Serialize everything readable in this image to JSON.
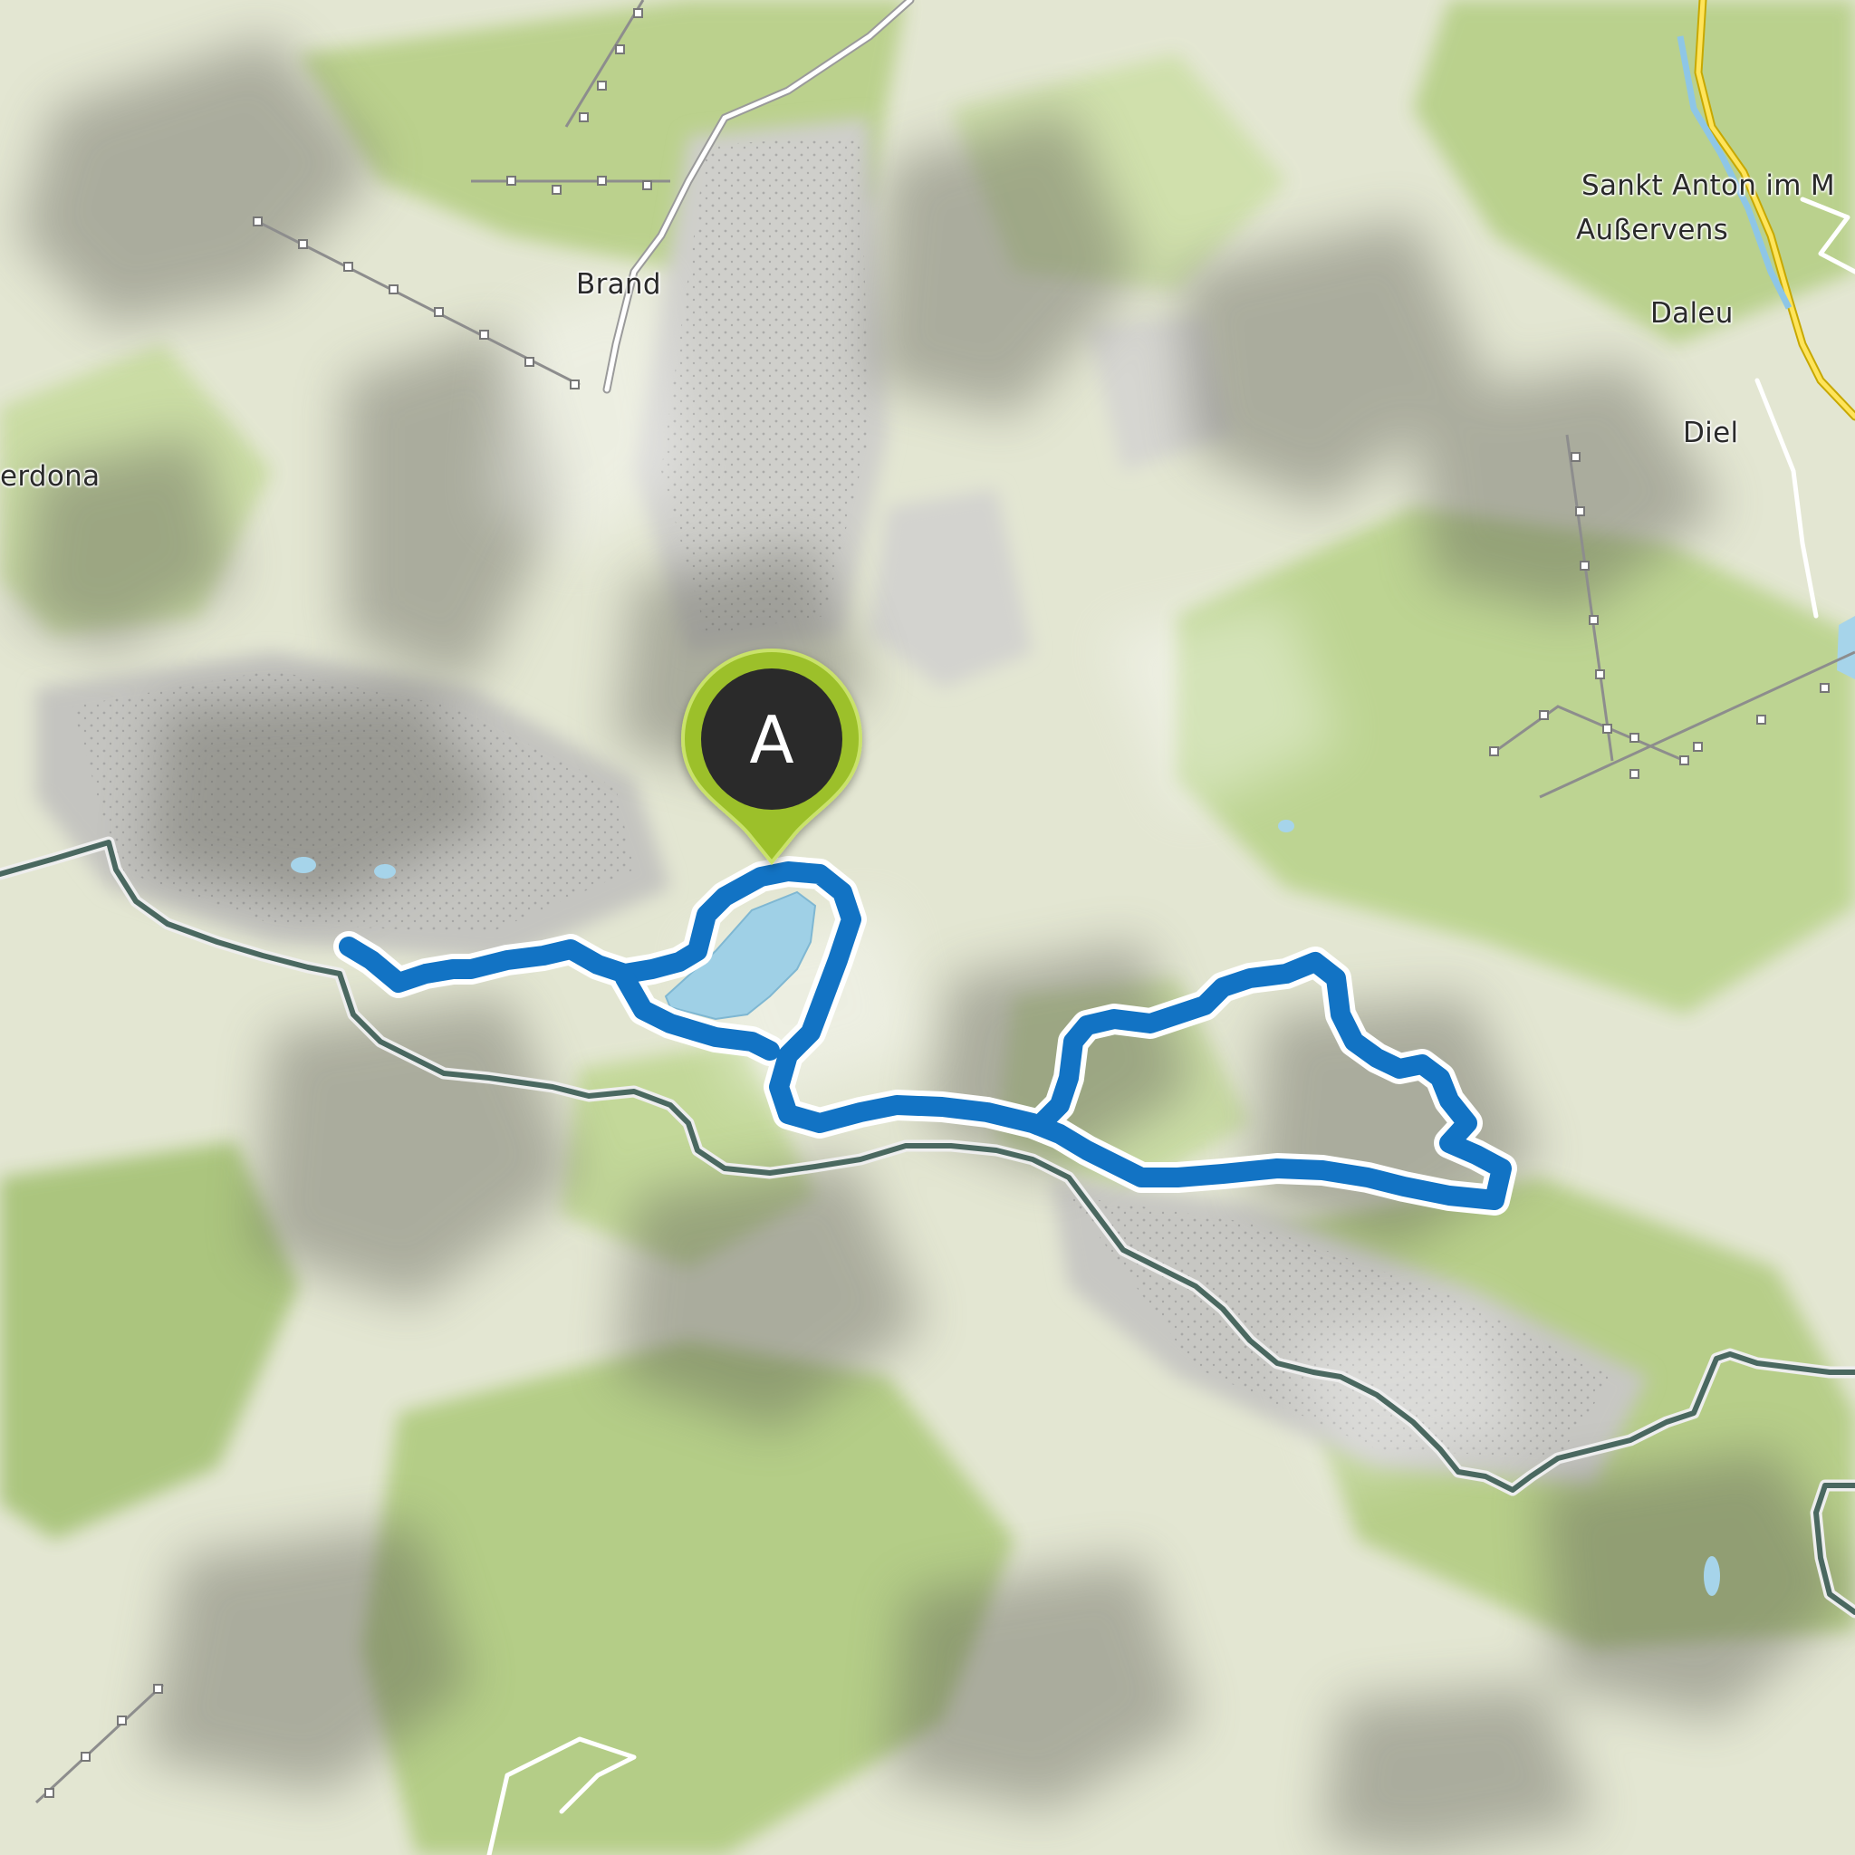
{
  "map": {
    "places": [
      {
        "id": "brand",
        "name": "Brand"
      },
      {
        "id": "verdona",
        "name": "erdona"
      },
      {
        "id": "sankt-anton",
        "name": "Sankt Anton im M"
      },
      {
        "id": "ausservens",
        "name": "Außervens"
      },
      {
        "id": "daleu",
        "name": "Daleu"
      },
      {
        "id": "diel",
        "name": "Diel"
      }
    ],
    "start_marker": {
      "label": "A"
    },
    "colors": {
      "route": "#1273c4",
      "route_outline": "#ffffff",
      "marker_fill": "#2b2b2b",
      "marker_ring": "#9cc02b",
      "lake": "#9fd0e6",
      "border": "#4a6860",
      "meadow": "#c4d99a",
      "rock": "#c6c6c6"
    },
    "icons": [
      "start-marker-icon"
    ]
  }
}
